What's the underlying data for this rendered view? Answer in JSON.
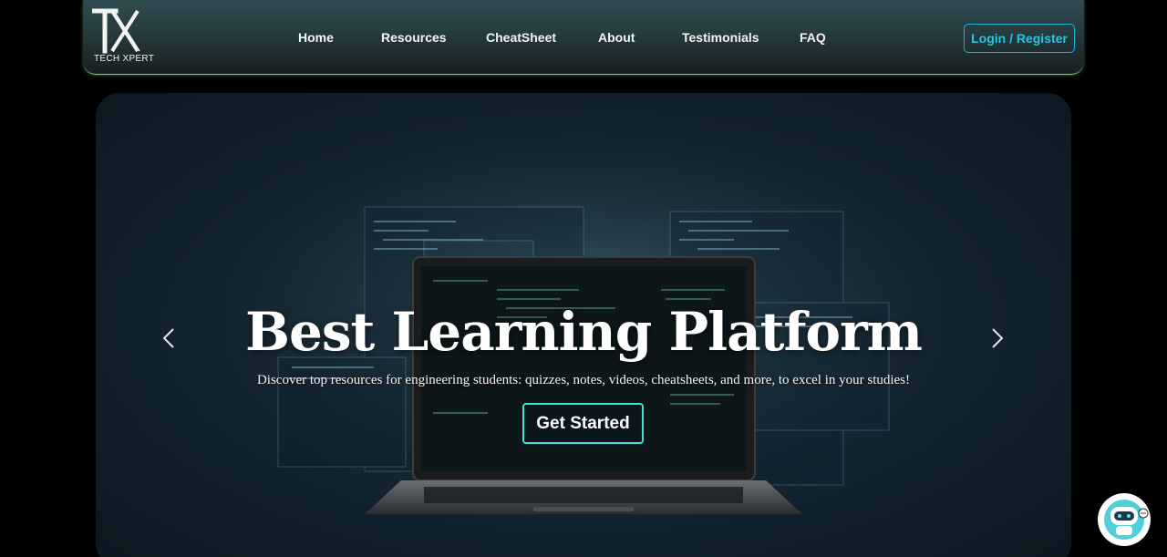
{
  "brand": {
    "logo_mark": "TX",
    "logo_text": "TECH XPERT"
  },
  "nav": {
    "items": [
      {
        "label": "Home"
      },
      {
        "label": "Resources"
      },
      {
        "label": "CheatSheet"
      },
      {
        "label": "About"
      },
      {
        "label": "Testimonials"
      },
      {
        "label": "FAQ"
      }
    ],
    "login_label": "Login / Register"
  },
  "hero": {
    "title": "Best Learning Platform",
    "subtitle": "Discover top resources for engineering students: quizzes, notes, videos, cheatsheets, and more, to excel in your studies!",
    "cta_label": "Get Started",
    "prev_icon": "chevron-left-icon",
    "next_icon": "chevron-right-icon"
  },
  "chatbot": {
    "icon": "robot-icon"
  },
  "colors": {
    "accent": "#2bc4e4",
    "cta_border": "#3fe0d8",
    "nav_border": "#7fd17b",
    "background": "#000000"
  }
}
